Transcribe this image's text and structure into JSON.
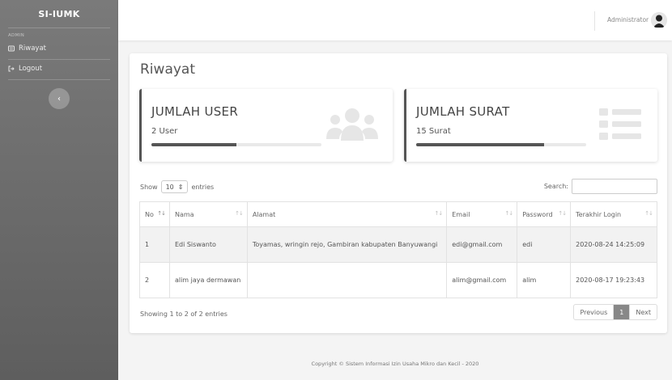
{
  "sidebar": {
    "brand": "SI-IUMK",
    "heading": "ADMIN",
    "items": [
      {
        "label": "Riwayat",
        "icon": "history-icon"
      },
      {
        "label": "Logout",
        "icon": "logout-icon"
      }
    ],
    "toggle_icon": "chevron-left-icon"
  },
  "topbar": {
    "user_name": "Administrator",
    "avatar_icon": "user-avatar-icon"
  },
  "page": {
    "title": "Riwayat"
  },
  "stats": {
    "users": {
      "title": "JUMLAH USER",
      "count": "2 User",
      "progress": 0.5,
      "icon": "users-icon"
    },
    "surat": {
      "title": "JUMLAH SURAT",
      "count": "15 Surat",
      "progress": 0.75,
      "icon": "list-icon"
    }
  },
  "table_controls": {
    "show_label": "Show",
    "entries_value": "10",
    "entries_label": "entries",
    "search_label": "Search:"
  },
  "table": {
    "columns": [
      "No",
      "Nama",
      "Alamat",
      "Email",
      "Password",
      "Terakhir Login"
    ],
    "rows": [
      {
        "no": "1",
        "nama": "Edi Siswanto",
        "alamat": "Toyamas, wringin rejo, Gambiran kabupaten Banyuwangi",
        "email": "edi@gmail.com",
        "password": "edi",
        "login": "2020-08-24 14:25:09"
      },
      {
        "no": "2",
        "nama": "alim jaya dermawan",
        "alamat": "",
        "email": "alim@gmail.com",
        "password": "alim",
        "login": "2020-08-17 19:23:43"
      }
    ]
  },
  "pagination": {
    "info": "Showing 1 to 2 of 2 entries",
    "previous": "Previous",
    "current": "1",
    "next": "Next"
  },
  "footer": {
    "text": "Copyright © Sistem Informasi Izin Usaha Mikro dan Kecil - 2020"
  },
  "colors": {
    "sidebar": "#6b6b6b",
    "accent": "#555555",
    "background": "#f4f4f4"
  }
}
